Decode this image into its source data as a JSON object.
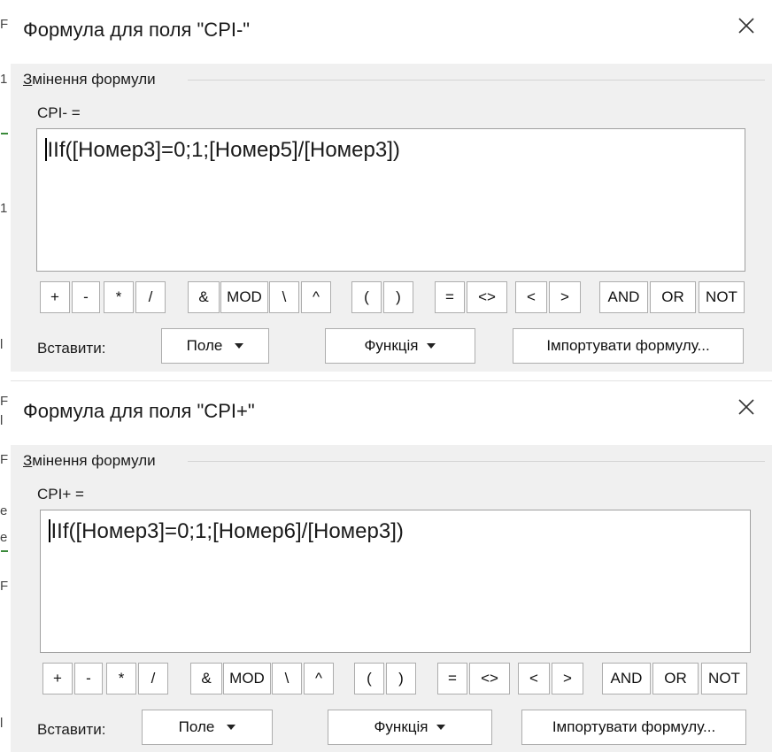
{
  "dialogs": [
    {
      "title": "Формула для поля \"CPI-\"",
      "group_title_underlined": "З",
      "group_title_rest": "мінення формули",
      "field_label": "CPI- =",
      "formula": "IIf([Номер3]=0;1;[Номер5]/[Номер3])",
      "insert_label": "Вставити:",
      "field_button": "Поле",
      "function_button": "Функція",
      "import_button": "Імпортувати формулу..."
    },
    {
      "title": "Формула для поля \"CPI+\"",
      "group_title_underlined": "З",
      "group_title_rest": "мінення формули",
      "field_label": "CPI+ =",
      "formula": "IIf([Номер3]=0;1;[Номер6]/[Номер3])",
      "insert_label": "Вставити:",
      "field_button": "Поле",
      "function_button": "Функція",
      "import_button": "Імпортувати формулу..."
    }
  ],
  "operators": [
    "+",
    "-",
    "*",
    "/",
    "&",
    "MOD",
    "\\",
    "^",
    "(",
    ")",
    "=",
    "<>",
    "<",
    ">",
    "AND",
    "OR",
    "NOT"
  ],
  "left_edge_glyphs": [
    "F",
    "1",
    "1",
    "l",
    "F",
    "l",
    "F",
    "e",
    "e",
    "F",
    "l",
    "l"
  ]
}
